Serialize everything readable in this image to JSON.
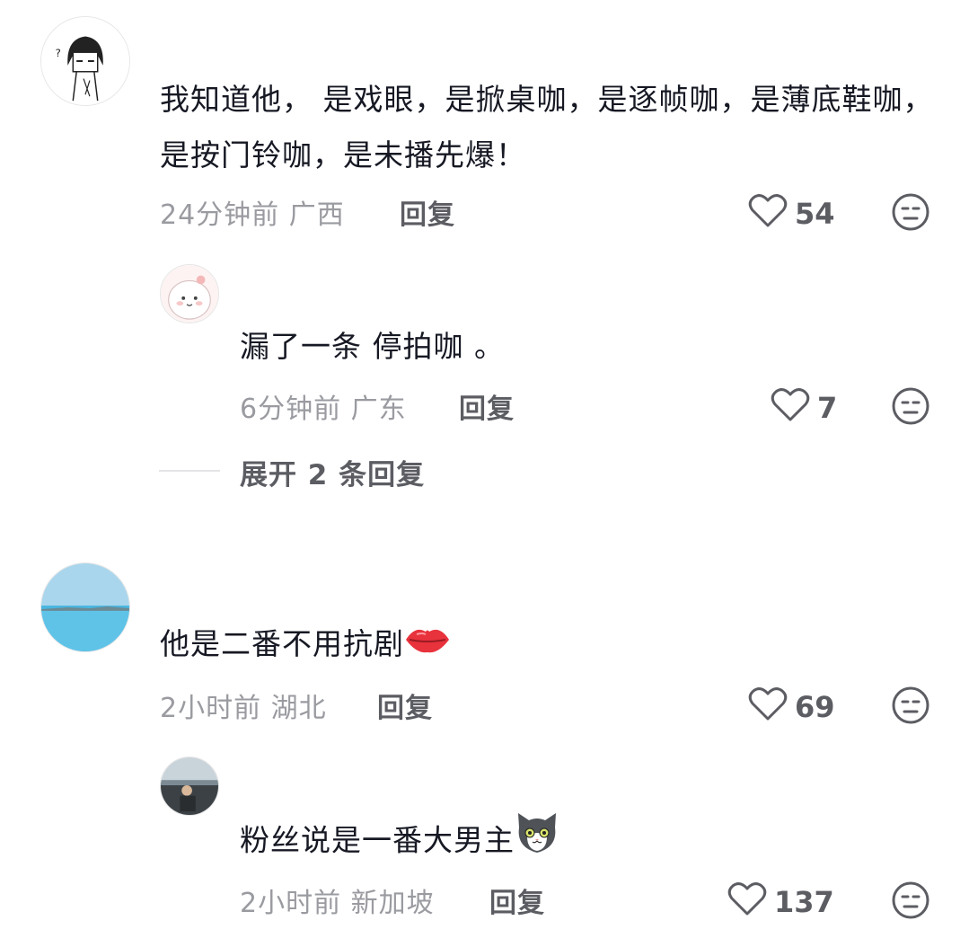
{
  "comments": [
    {
      "text": "我知道他， 是戏眼，是掀桌咖，是逐帧咖，是薄底鞋咖，是按门铃咖，是未播先爆！",
      "time_location": "24分钟前 广西",
      "reply_label": "回复",
      "likes": "54"
    },
    {
      "text": "漏了一条 停拍咖 。",
      "time_location": "6分钟前 广东",
      "reply_label": "回复",
      "likes": "7"
    },
    {
      "text": "他是二番不用抗剧",
      "emoji": "kiss-lips-icon",
      "time_location": "2小时前 湖北",
      "reply_label": "回复",
      "likes": "69"
    },
    {
      "text": "粉丝说是一番大男主",
      "emoji": "cat-face-icon",
      "time_location": "2小时前 新加坡",
      "reply_label": "回复",
      "likes": "137"
    }
  ],
  "expand_replies": "展开 2 条回复",
  "colors": {
    "text": "#161823",
    "meta": "#9a9ba0",
    "action": "#5c5d63"
  }
}
